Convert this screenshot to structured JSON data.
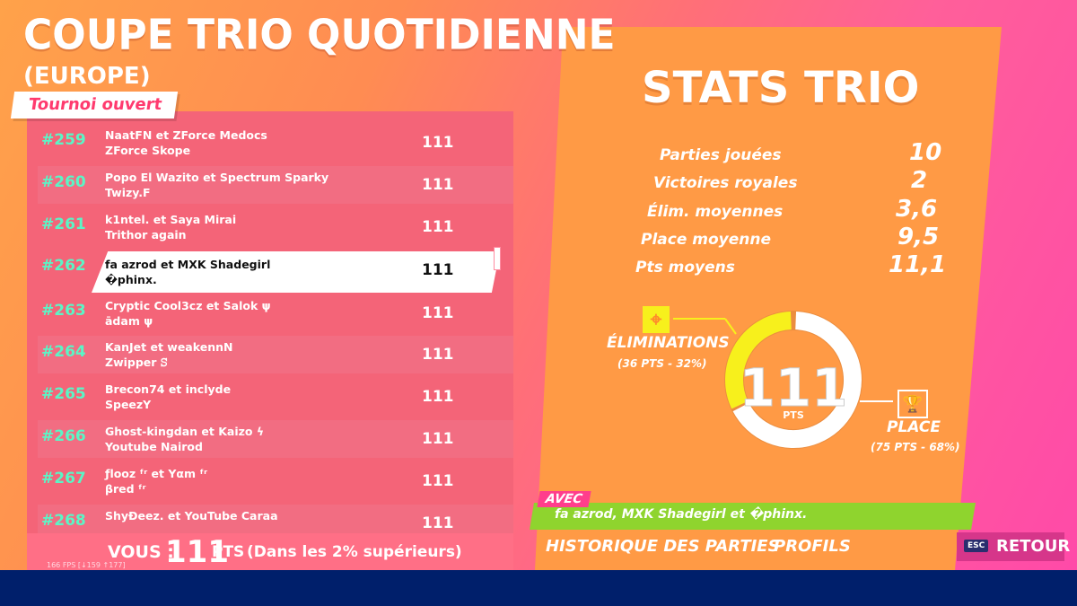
{
  "header": {
    "title": "COUPE TRIO QUOTIDIENNE",
    "region": "(EUROPE)",
    "status_badge": "Tournoi ouvert"
  },
  "leaderboard": {
    "rows": [
      {
        "rank": "#259",
        "line1": "NaatFN et ZForce Medocs",
        "line2": "ZForce Skope",
        "points": "111"
      },
      {
        "rank": "#260",
        "line1": "Popo El Wazito et Spectrum Sparky",
        "line2": "Twizy.F",
        "points": "111"
      },
      {
        "rank": "#261",
        "line1": "k1ntel. et Saya Mirai",
        "line2": "Trithor again",
        "points": "111"
      },
      {
        "rank": "#262",
        "line1": "fa azrod et MXK Shadegirl",
        "line2": "�phinx.",
        "points": "111"
      },
      {
        "rank": "#263",
        "line1": "Cryptic Cool3cz et Salok ψ",
        "line2": "ādam ψ",
        "points": "111"
      },
      {
        "rank": "#264",
        "line1": "KanJet et weakennN",
        "line2": "Zwipper ꕶ",
        "points": "111"
      },
      {
        "rank": "#265",
        "line1": "Brecon74 et inclyde",
        "line2": "SpeezY",
        "points": "111"
      },
      {
        "rank": "#266",
        "line1": "Ghost-kingdan et Kaizo ϟ",
        "line2": "Youtube Nairod",
        "points": "111"
      },
      {
        "rank": "#267",
        "line1": "ƒlooz ᶠʳ et Yαm ᶠʳ",
        "line2": "βred ᶠʳ",
        "points": "111"
      },
      {
        "rank": "#268",
        "line1": "ShyÐeez. et YouTube Caraa",
        "line2": "",
        "points": "111"
      }
    ]
  },
  "you": {
    "label": "VOUS :",
    "points": "111",
    "unit": "PTS",
    "rank_text": "(Dans les 2% supérieurs)"
  },
  "fps_readout": "166 FPS [↓159 ↑177]",
  "stats": {
    "title": "STATS TRIO",
    "items": [
      {
        "label": "Parties jouées",
        "value": "10"
      },
      {
        "label": "Victoires royales",
        "value": "2"
      },
      {
        "label": "Élim. moyennes",
        "value": "3,6"
      },
      {
        "label": "Place moyenne",
        "value": "9,5"
      },
      {
        "label": "Pts moyens",
        "value": "11,1"
      }
    ]
  },
  "donut": {
    "total": "111",
    "unit": "PTS",
    "eliminations_fraction": 0.32,
    "colors": {
      "elim": "#f7f01c",
      "place": "#ffffff"
    }
  },
  "breakdown": {
    "eliminations_label": "ÉLIMINATIONS",
    "eliminations_detail": "(36 PTS - 32%)",
    "place_label": "PLACE",
    "place_detail": "(75 PTS - 68%)"
  },
  "teammates": {
    "badge": "AVEC",
    "names": "fa azrod, MXK Shadegirl et �phinx."
  },
  "footer": {
    "history_link": "HISTORIQUE DES PARTIES",
    "profiles_link": "PROFILS",
    "esc_key": "ESC",
    "back_label": "RETOUR"
  }
}
